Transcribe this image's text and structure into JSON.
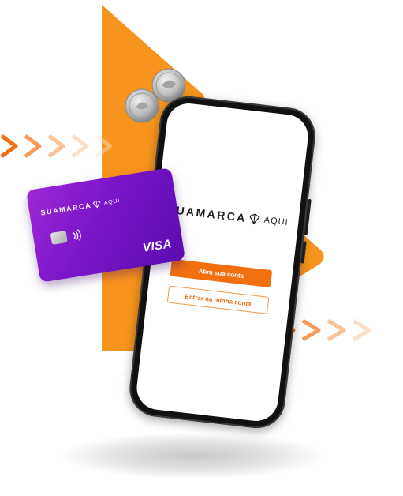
{
  "app": {
    "brand_name": "SUAMARCA",
    "brand_suffix": "AQUI"
  },
  "screen": {
    "primary_button": "Abra sua conta",
    "secondary_button": "Entrar na minha conta"
  },
  "card": {
    "brand_name": "SUAMARCA",
    "brand_suffix": "AQUI",
    "network": "VISA"
  },
  "icons": [
    "logo-mark-icon",
    "chip-icon",
    "contactless-icon",
    "coin-icon",
    "chevron-arrows-icon"
  ],
  "colors": {
    "accent_orange": "#F7941D",
    "button_orange": "#F26F10",
    "card_purple": "#7A14C9"
  }
}
